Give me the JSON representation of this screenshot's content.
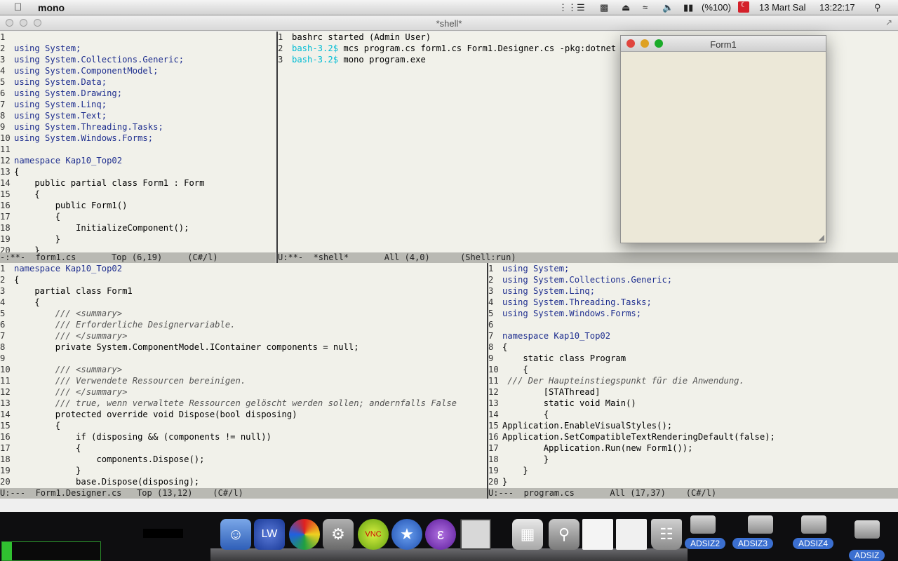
{
  "menubar": {
    "app_name": "mono",
    "battery": "(%100)",
    "date": "13 Mart Sal",
    "time": "13:22:17"
  },
  "window": {
    "title": "*shell*"
  },
  "pane_form1": {
    "lines": [
      {
        "n": "1",
        "t": ""
      },
      {
        "n": "2",
        "t": "using System;"
      },
      {
        "n": "3",
        "t": "using System.Collections.Generic;"
      },
      {
        "n": "4",
        "t": "using System.ComponentModel;"
      },
      {
        "n": "5",
        "t": "using System.Data;"
      },
      {
        "n": "6",
        "t": "using System.Drawing;"
      },
      {
        "n": "7",
        "t": "using System.Linq;"
      },
      {
        "n": "8",
        "t": "using System.Text;"
      },
      {
        "n": "9",
        "t": "using System.Threading.Tasks;"
      },
      {
        "n": "10",
        "t": "using System.Windows.Forms;"
      },
      {
        "n": "11",
        "t": ""
      },
      {
        "n": "12",
        "t": "namespace Kap10_Top02"
      },
      {
        "n": "13",
        "t": "{"
      },
      {
        "n": "14",
        "t": "    public partial class Form1 : Form"
      },
      {
        "n": "15",
        "t": "    {"
      },
      {
        "n": "16",
        "t": "        public Form1()"
      },
      {
        "n": "17",
        "t": "        {"
      },
      {
        "n": "18",
        "t": "            InitializeComponent();"
      },
      {
        "n": "19",
        "t": "        }"
      },
      {
        "n": "20",
        "t": "    }"
      }
    ],
    "modeline": "-:**-  form1.cs       Top (6,19)     (C#/l)"
  },
  "pane_shell": {
    "lines": [
      {
        "n": "1",
        "prompt": "",
        "t": "bashrc started (Admin User)"
      },
      {
        "n": "2",
        "prompt": "bash-3.2$",
        "t": " mcs program.cs form1.cs Form1.Designer.cs -pkg:dotnet"
      },
      {
        "n": "3",
        "prompt": "bash-3.2$",
        "t": " mono program.exe"
      },
      {
        "n": "",
        "prompt": "",
        "t": ""
      }
    ],
    "modeline": "U:**-  *shell*       All (4,0)      (Shell:run)"
  },
  "form1_window": {
    "title": "Form1"
  },
  "pane_designer": {
    "lines": [
      {
        "n": "1",
        "t": "namespace Kap10_Top02"
      },
      {
        "n": "2",
        "t": "{"
      },
      {
        "n": "3",
        "t": "    partial class Form1"
      },
      {
        "n": "4",
        "t": "    {"
      },
      {
        "n": "5",
        "t": "        /// <summary>"
      },
      {
        "n": "6",
        "t": "        /// Erforderliche Designervariable."
      },
      {
        "n": "7",
        "t": "        /// </summary>"
      },
      {
        "n": "8",
        "t": "        private System.ComponentModel.IContainer components = null;"
      },
      {
        "n": "9",
        "t": ""
      },
      {
        "n": "10",
        "t": "        /// <summary>"
      },
      {
        "n": "11",
        "t": "        /// Verwendete Ressourcen bereinigen."
      },
      {
        "n": "12",
        "t": "        /// </summary>"
      },
      {
        "n": "13",
        "t": "        /// true, wenn verwaltete Ressourcen gelöscht werden sollen; andernfalls False"
      },
      {
        "n": "14",
        "t": "        protected override void Dispose(bool disposing)"
      },
      {
        "n": "15",
        "t": "        {"
      },
      {
        "n": "16",
        "t": "            if (disposing && (components != null))"
      },
      {
        "n": "17",
        "t": "            {"
      },
      {
        "n": "18",
        "t": "                components.Dispose();"
      },
      {
        "n": "19",
        "t": "            }"
      },
      {
        "n": "20",
        "t": "            base.Dispose(disposing);"
      }
    ],
    "modeline": "U:---  Form1.Designer.cs   Top (13,12)    (C#/l)"
  },
  "pane_program": {
    "lines": [
      {
        "n": "1",
        "t": "using System;"
      },
      {
        "n": "2",
        "t": "using System.Collections.Generic;"
      },
      {
        "n": "3",
        "t": "using System.Linq;"
      },
      {
        "n": "4",
        "t": "using System.Threading.Tasks;"
      },
      {
        "n": "5",
        "t": "using System.Windows.Forms;"
      },
      {
        "n": "6",
        "t": ""
      },
      {
        "n": "7",
        "t": "namespace Kap10_Top02"
      },
      {
        "n": "8",
        "t": "{"
      },
      {
        "n": "9",
        "t": "    static class Program"
      },
      {
        "n": "10",
        "t": "    {"
      },
      {
        "n": "11",
        "t": " /// Der Haupteinstiegspunkt für die Anwendung."
      },
      {
        "n": "12",
        "t": "        [STAThread]"
      },
      {
        "n": "13",
        "t": "        static void Main()"
      },
      {
        "n": "14",
        "t": "        {"
      },
      {
        "n": "15",
        "t": "Application.EnableVisualStyles();"
      },
      {
        "n": "16",
        "t": "Application.SetCompatibleTextRenderingDefault(false);"
      },
      {
        "n": "17",
        "t": "        Application.Run(new Form1());"
      },
      {
        "n": "18",
        "t": "        }"
      },
      {
        "n": "19",
        "t": "    }"
      },
      {
        "n": "20",
        "t": "}"
      }
    ],
    "modeline": "U:---  program.cs       All (17,37)    (C#/l)"
  },
  "dock": {
    "labels": [
      "ADSIZ2",
      "ADSIZ3",
      "ADSIZ4",
      "ADSIZ"
    ],
    "icons": [
      "finder-icon",
      "lw-icon",
      "color-wheel-icon",
      "system-preferences-icon",
      "server-vnc-icon",
      "xcode-icon",
      "emacs-icon",
      "terminal-icon",
      "photo-booth-icon",
      "keychain-icon",
      "activity-monitor-icon",
      "preview-icon",
      "trash-icon"
    ]
  }
}
